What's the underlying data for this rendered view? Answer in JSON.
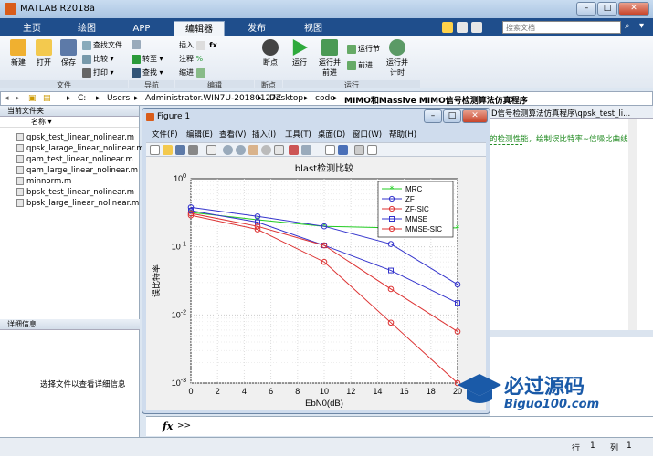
{
  "window": {
    "title": "MATLAB R2018a"
  },
  "tabs": [
    "主页",
    "绘图",
    "APP",
    "编辑器",
    "发布",
    "视图"
  ],
  "active_tab": "编辑器",
  "search": {
    "placeholder": "搜索文档"
  },
  "ribbon": {
    "file": {
      "new": "新建",
      "open": "打开",
      "save": "保存",
      "find_files": "查找文件",
      "compare": "比较",
      "print": "打印",
      "section": "文件"
    },
    "nav": {
      "goto": "转至",
      "find": "查找",
      "section": "导航"
    },
    "edit": {
      "insert": "插入",
      "comment": "注释",
      "indent": "缩进",
      "section": "编辑"
    },
    "breakpoints": {
      "label": "断点",
      "section": "断点"
    },
    "run": {
      "run": "运行",
      "run_advance": "运行并前进",
      "run_section": "运行节",
      "advance": "前进",
      "run_time": "运行并计时",
      "section": "运行"
    }
  },
  "path": [
    "C:",
    "Users",
    "Administrator.WIN7U-20180127Z",
    "Desktop",
    "code",
    "MIMO和Massive MIMO信号检测算法仿真程序"
  ],
  "current_folder": {
    "title": "当前文件夹",
    "col": "名称",
    "files": [
      "qpsk_test_linear_nolinear.m",
      "qpsk_larage_linear_nolinear.m",
      "qam_test_linear_nolinear.m",
      "qam_large_linear_nolinear.m",
      "minnorm.m",
      "bpsk_test_linear_nolinear.m",
      "bpsk_large_linear_nolinear.m"
    ]
  },
  "details": {
    "title": "详细信息",
    "hint": "选择文件以查看详细信息"
  },
  "editor_tab_text": "D信号检测算法仿真程序\\qpsk_test_li...",
  "editor_comment": "的检测性能，绘制误比特率~信噪比曲线",
  "figure": {
    "title": "Figure 1",
    "menus": [
      "文件(F)",
      "编辑(E)",
      "查看(V)",
      "插入(I)",
      "工具(T)",
      "桌面(D)",
      "窗口(W)",
      "帮助(H)"
    ]
  },
  "statusbar": {
    "row_label": "行",
    "row": "1",
    "col_label": "列",
    "col": "1"
  },
  "prompt": ">>",
  "watermark": {
    "name": "必过源码",
    "url": "Biguo100.com"
  },
  "colors": {
    "green": "#22cc22",
    "blue": "#3333cc",
    "red": "#dd3333"
  },
  "chart_data": {
    "type": "line",
    "title": "blast检测比较",
    "xlabel": "EbN0(dB)",
    "ylabel": "误比特率",
    "yscale": "log",
    "xlim": [
      0,
      20
    ],
    "ylim": [
      0.001,
      1
    ],
    "xticks": [
      0,
      2,
      4,
      6,
      8,
      10,
      12,
      14,
      16,
      18,
      20
    ],
    "yticks": [
      "10^0",
      "10^-1",
      "10^-2",
      "10^-3"
    ],
    "grid": true,
    "legend_position": "top-right",
    "x": [
      0,
      5,
      10,
      15,
      20
    ],
    "series": [
      {
        "name": "MRC",
        "color": "#22cc22",
        "marker": "star",
        "values": [
          0.32,
          0.25,
          0.2,
          0.19,
          0.19
        ]
      },
      {
        "name": "ZF",
        "color": "#3333cc",
        "marker": "circle",
        "values": [
          0.38,
          0.28,
          0.2,
          0.11,
          0.028
        ]
      },
      {
        "name": "ZF-SIC",
        "color": "#dd3333",
        "marker": "circle",
        "values": [
          0.29,
          0.18,
          0.06,
          0.0077,
          0.0006
        ]
      },
      {
        "name": "MMSE",
        "color": "#3333cc",
        "marker": "square",
        "values": [
          0.34,
          0.23,
          0.105,
          0.045,
          0.015
        ]
      },
      {
        "name": "MMSE-SIC",
        "color": "#dd3333",
        "marker": "circle",
        "values": [
          0.31,
          0.2,
          0.105,
          0.024,
          0.0057
        ]
      }
    ]
  }
}
